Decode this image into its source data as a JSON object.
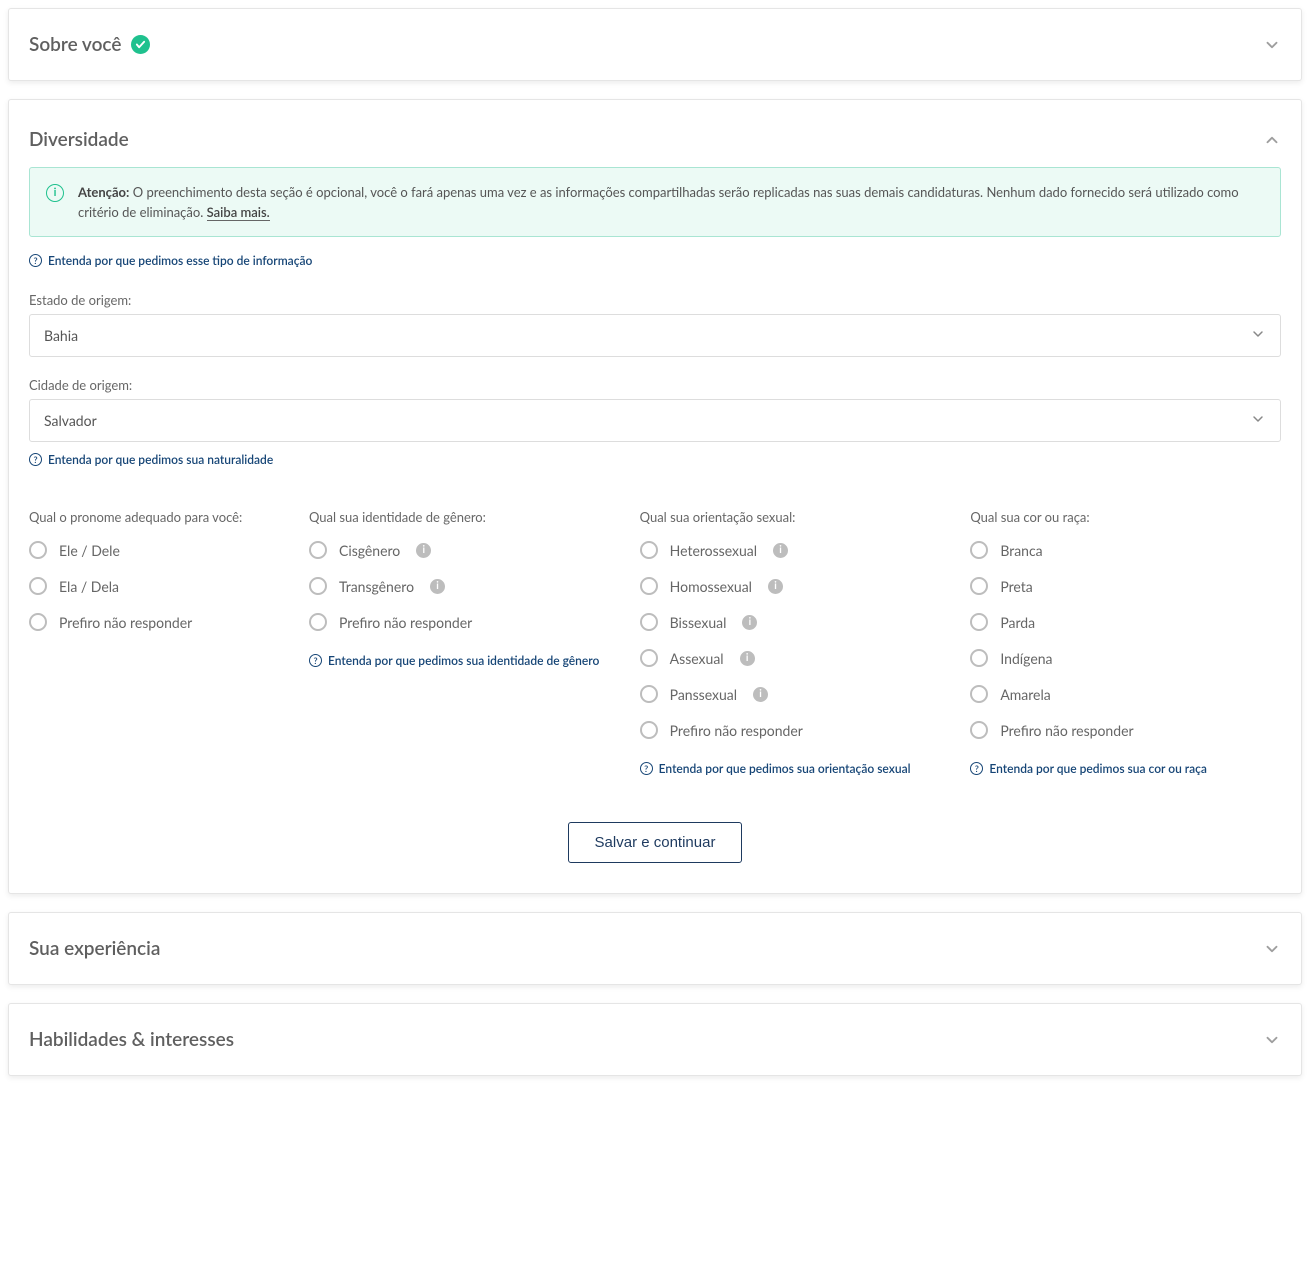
{
  "sections": {
    "about": {
      "title": "Sobre você",
      "completed": true
    },
    "diversity": {
      "title": "Diversidade"
    },
    "experience": {
      "title": "Sua experiência"
    },
    "skills": {
      "title": "Habilidades & interesses"
    }
  },
  "alert": {
    "strong": "Atenção:",
    "text": " O preenchimento desta seção é opcional, você o fará apenas uma vez e as informações compartilhadas serão replicadas nas suas demais candidaturas. Nenhum dado fornecido será utilizado como critério de eliminação. ",
    "learn_more": "Saiba mais."
  },
  "help_links": {
    "info_type": "Entenda por que pedimos esse tipo de informação",
    "naturalidade": "Entenda por que pedimos sua naturalidade",
    "gender_identity": "Entenda por que pedimos sua identidade de gênero",
    "orientation": "Entenda por que pedimos sua orientação sexual",
    "race": "Entenda por que pedimos sua cor ou raça"
  },
  "fields": {
    "state": {
      "label": "Estado de origem:",
      "value": "Bahia"
    },
    "city": {
      "label": "Cidade de origem:",
      "value": "Salvador"
    }
  },
  "groups": {
    "pronoun": {
      "title": "Qual o pronome adequado para você:",
      "options": [
        {
          "label": "Ele / Dele"
        },
        {
          "label": "Ela / Dela"
        },
        {
          "label": "Prefiro não responder"
        }
      ]
    },
    "gender": {
      "title": "Qual sua identidade de gênero:",
      "options": [
        {
          "label": "Cisgênero",
          "tip": true
        },
        {
          "label": "Transgênero",
          "tip": true
        },
        {
          "label": "Prefiro não responder"
        }
      ]
    },
    "orientation": {
      "title": "Qual sua orientação sexual:",
      "options": [
        {
          "label": "Heterossexual",
          "tip": true
        },
        {
          "label": "Homossexual",
          "tip": true
        },
        {
          "label": "Bissexual",
          "tip": true
        },
        {
          "label": "Assexual",
          "tip": true
        },
        {
          "label": "Panssexual",
          "tip": true
        },
        {
          "label": "Prefiro não responder"
        }
      ]
    },
    "race": {
      "title": "Qual sua cor ou raça:",
      "options": [
        {
          "label": "Branca"
        },
        {
          "label": "Preta"
        },
        {
          "label": "Parda"
        },
        {
          "label": "Indígena"
        },
        {
          "label": "Amarela"
        },
        {
          "label": "Prefiro não responder"
        }
      ]
    }
  },
  "buttons": {
    "save": "Salvar e continuar"
  }
}
